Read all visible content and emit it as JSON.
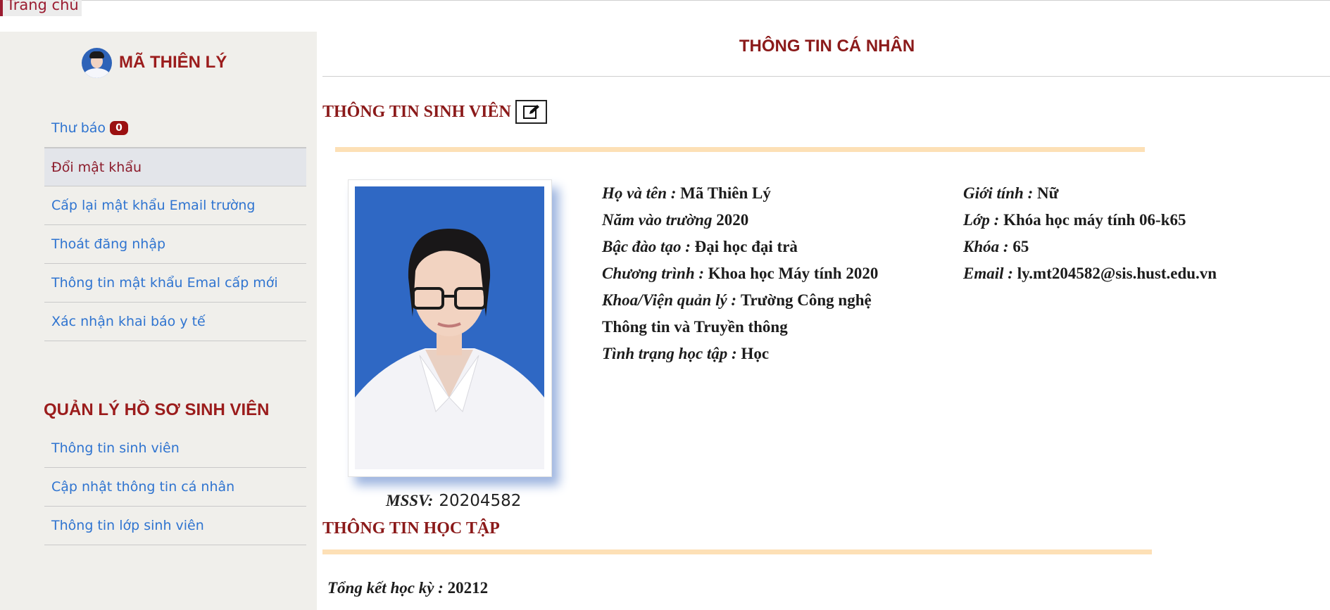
{
  "nav": {
    "home": "Trang chủ"
  },
  "user": {
    "name": "MÃ THIÊN LÝ"
  },
  "sidebar": {
    "account_items": [
      {
        "label": "Thư báo",
        "badge": "0"
      },
      {
        "label": "Đổi mật khẩu"
      },
      {
        "label": "Cấp lại mật khẩu Email trường"
      },
      {
        "label": "Thoát đăng nhập"
      },
      {
        "label": "Thông tin mật khẩu Emal cấp mới"
      },
      {
        "label": "Xác nhận khai báo y tế"
      }
    ],
    "section_title": "QUẢN LÝ HỒ SƠ SINH VIÊN",
    "profile_items": [
      {
        "label": "Thông tin sinh viên"
      },
      {
        "label": "Cập nhật thông tin cá nhân"
      },
      {
        "label": "Thông tin lớp sinh viên"
      }
    ]
  },
  "main": {
    "page_title": "THÔNG TIN CÁ NHÂN",
    "student_section_title": "THÔNG TIN SINH VIÊN",
    "mssv_label": "MSSV:",
    "mssv_value": "20204582",
    "info_left": [
      {
        "label": "Họ và tên",
        "sep": " : ",
        "value": "Mã Thiên Lý"
      },
      {
        "label": "Năm vào trường",
        "sep": " ",
        "value": "2020"
      },
      {
        "label": "Bậc đào tạo",
        "sep": " : ",
        "value": "Đại học đại trà"
      },
      {
        "label": "Chương trình",
        "sep": " : ",
        "value": "Khoa học Máy tính 2020"
      },
      {
        "label": "Khoa/Viện quản lý",
        "sep": " : ",
        "value": "Trường Công nghệ"
      },
      {
        "label": "",
        "sep": "",
        "value": "Thông tin và Truyền thông"
      },
      {
        "label": "Tình trạng học tập",
        "sep": " : ",
        "value": "Học"
      }
    ],
    "info_right": [
      {
        "label": "Giới tính",
        "sep": " : ",
        "value": "Nữ"
      },
      {
        "label": "Lớp",
        "sep": " : ",
        "value": "Khóa học máy tính 06-k65"
      },
      {
        "label": "Khóa",
        "sep": " : ",
        "value": "65"
      },
      {
        "label": "Email",
        "sep": " : ",
        "value": "ly.mt204582@sis.hust.edu.vn"
      }
    ],
    "study_section_title": "THÔNG TIN HỌC TẬP",
    "summary_label": "Tổng kết học kỳ",
    "summary_sep": " : ",
    "summary_value": "20212"
  },
  "colors": {
    "accent": "#9b1c1c",
    "link": "#2f74d0",
    "divider_bar": "#fde0b6",
    "sidebar_bg": "#f0efeb"
  },
  "icons": [
    "edit-icon"
  ]
}
